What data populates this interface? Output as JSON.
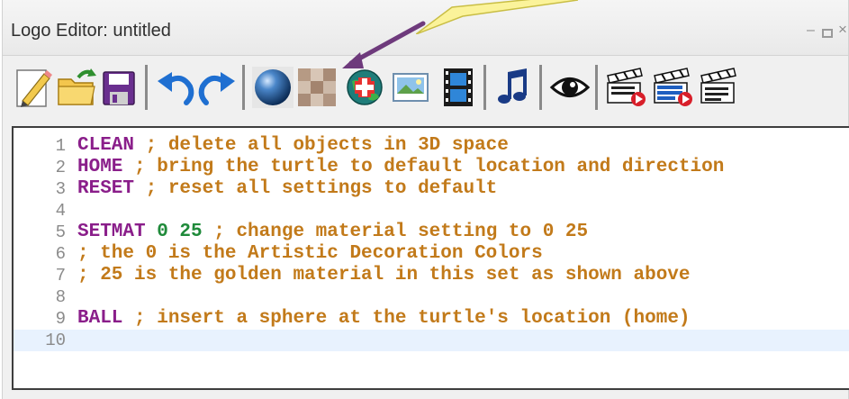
{
  "window": {
    "title": "Logo Editor: untitled",
    "controls": [
      "minimize",
      "maximize",
      "close"
    ]
  },
  "toolbar": {
    "buttons": [
      {
        "name": "new-file",
        "icon": "pencil-paper-icon"
      },
      {
        "name": "open-file",
        "icon": "folder-arrow-icon"
      },
      {
        "name": "save-file",
        "icon": "floppy-disk-icon"
      },
      {
        "name": "undo",
        "icon": "undo-arrow-icon"
      },
      {
        "name": "redo",
        "icon": "redo-arrow-icon"
      },
      {
        "name": "material",
        "icon": "sphere-icon"
      },
      {
        "name": "texture",
        "icon": "texture-tiles-icon"
      },
      {
        "name": "insert-object",
        "icon": "globe-plus-icon"
      },
      {
        "name": "image",
        "icon": "picture-icon"
      },
      {
        "name": "video",
        "icon": "film-strip-icon"
      },
      {
        "name": "music",
        "icon": "music-note-icon"
      },
      {
        "name": "view",
        "icon": "eye-icon"
      },
      {
        "name": "clip-1",
        "icon": "clapperboard-play-icon"
      },
      {
        "name": "clip-2",
        "icon": "clapperboard-list-icon"
      },
      {
        "name": "clip-3",
        "icon": "clapperboard-icon"
      }
    ]
  },
  "editor": {
    "current_line": 10,
    "lines": [
      {
        "n": "1",
        "kw": "CLEAN",
        "num": "",
        "comment": " ; delete all objects in 3D space"
      },
      {
        "n": "2",
        "kw": "HOME",
        "num": "",
        "comment": " ; bring the turtle to default location and direction"
      },
      {
        "n": "3",
        "kw": "RESET",
        "num": "",
        "comment": " ; reset all settings to default"
      },
      {
        "n": "4",
        "kw": "",
        "num": "",
        "comment": ""
      },
      {
        "n": "5",
        "kw": "SETMAT",
        "num": " 0 25",
        "comment": " ; change material setting to 0 25"
      },
      {
        "n": "6",
        "kw": "",
        "num": "",
        "comment": "; the 0 is the Artistic Decoration Colors"
      },
      {
        "n": "7",
        "kw": "",
        "num": "",
        "comment": "; 25 is the golden material in this set as shown above"
      },
      {
        "n": "8",
        "kw": "",
        "num": "",
        "comment": ""
      },
      {
        "n": "9",
        "kw": "BALL",
        "num": "",
        "comment": " ; insert a sphere at the turtle's location (home)"
      },
      {
        "n": "10",
        "kw": "",
        "num": "",
        "comment": ""
      }
    ]
  },
  "colors": {
    "keyword": "#8a1e8a",
    "number": "#1f8a3a",
    "comment": "#c27a1a",
    "callout": "#fbf39a",
    "arrow": "#6e3a7c"
  }
}
